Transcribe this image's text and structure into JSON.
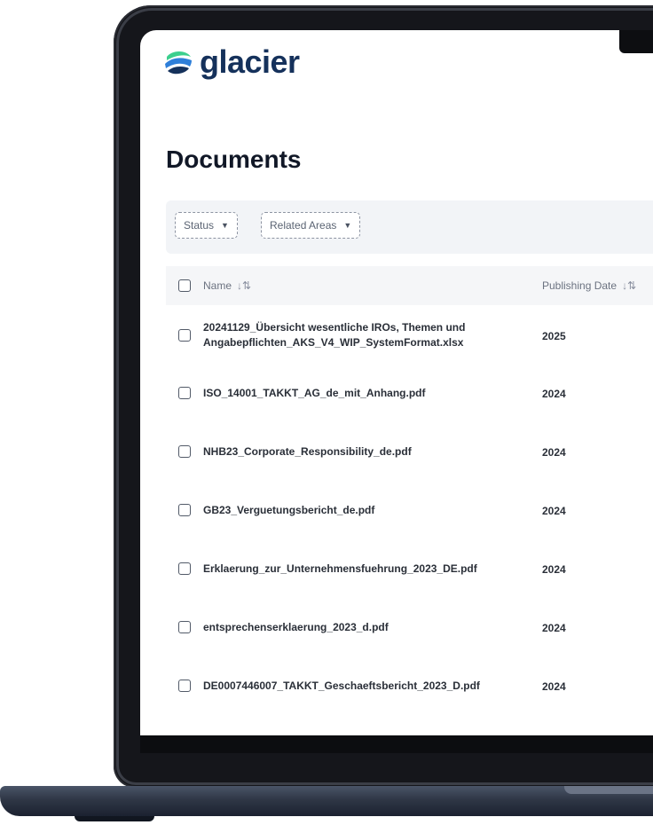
{
  "app": {
    "logo_text": "glacier"
  },
  "page": {
    "title": "Documents"
  },
  "filters": [
    {
      "label": "Status"
    },
    {
      "label": "Related Areas"
    }
  ],
  "table": {
    "columns": {
      "name": "Name",
      "publishing_date": "Publishing Date"
    },
    "rows": [
      {
        "name_line1": "20241129_Übersicht wesentliche IROs, Themen und",
        "name_line2": "Angabepflichten_AKS_V4_WIP_SystemFormat.xlsx",
        "date": "2025"
      },
      {
        "name_line1": "ISO_14001_TAKKT_AG_de_mit_Anhang.pdf",
        "name_line2": "",
        "date": "2024"
      },
      {
        "name_line1": "NHB23_Corporate_Responsibility_de.pdf",
        "name_line2": "",
        "date": "2024"
      },
      {
        "name_line1": "GB23_Verguetungsbericht_de.pdf",
        "name_line2": "",
        "date": "2024"
      },
      {
        "name_line1": "Erklaerung_zur_Unternehmensfuehrung_2023_DE.pdf",
        "name_line2": "",
        "date": "2024"
      },
      {
        "name_line1": "entsprechenserklaerung_2023_d.pdf",
        "name_line2": "",
        "date": "2024"
      },
      {
        "name_line1": "DE0007446007_TAKKT_Geschaeftsbericht_2023_D.pdf",
        "name_line2": "",
        "date": "2024"
      }
    ]
  },
  "colors": {
    "brand_navy": "#15315b",
    "brand_green": "#3ccf8e",
    "brand_blue": "#2e7fd9"
  }
}
